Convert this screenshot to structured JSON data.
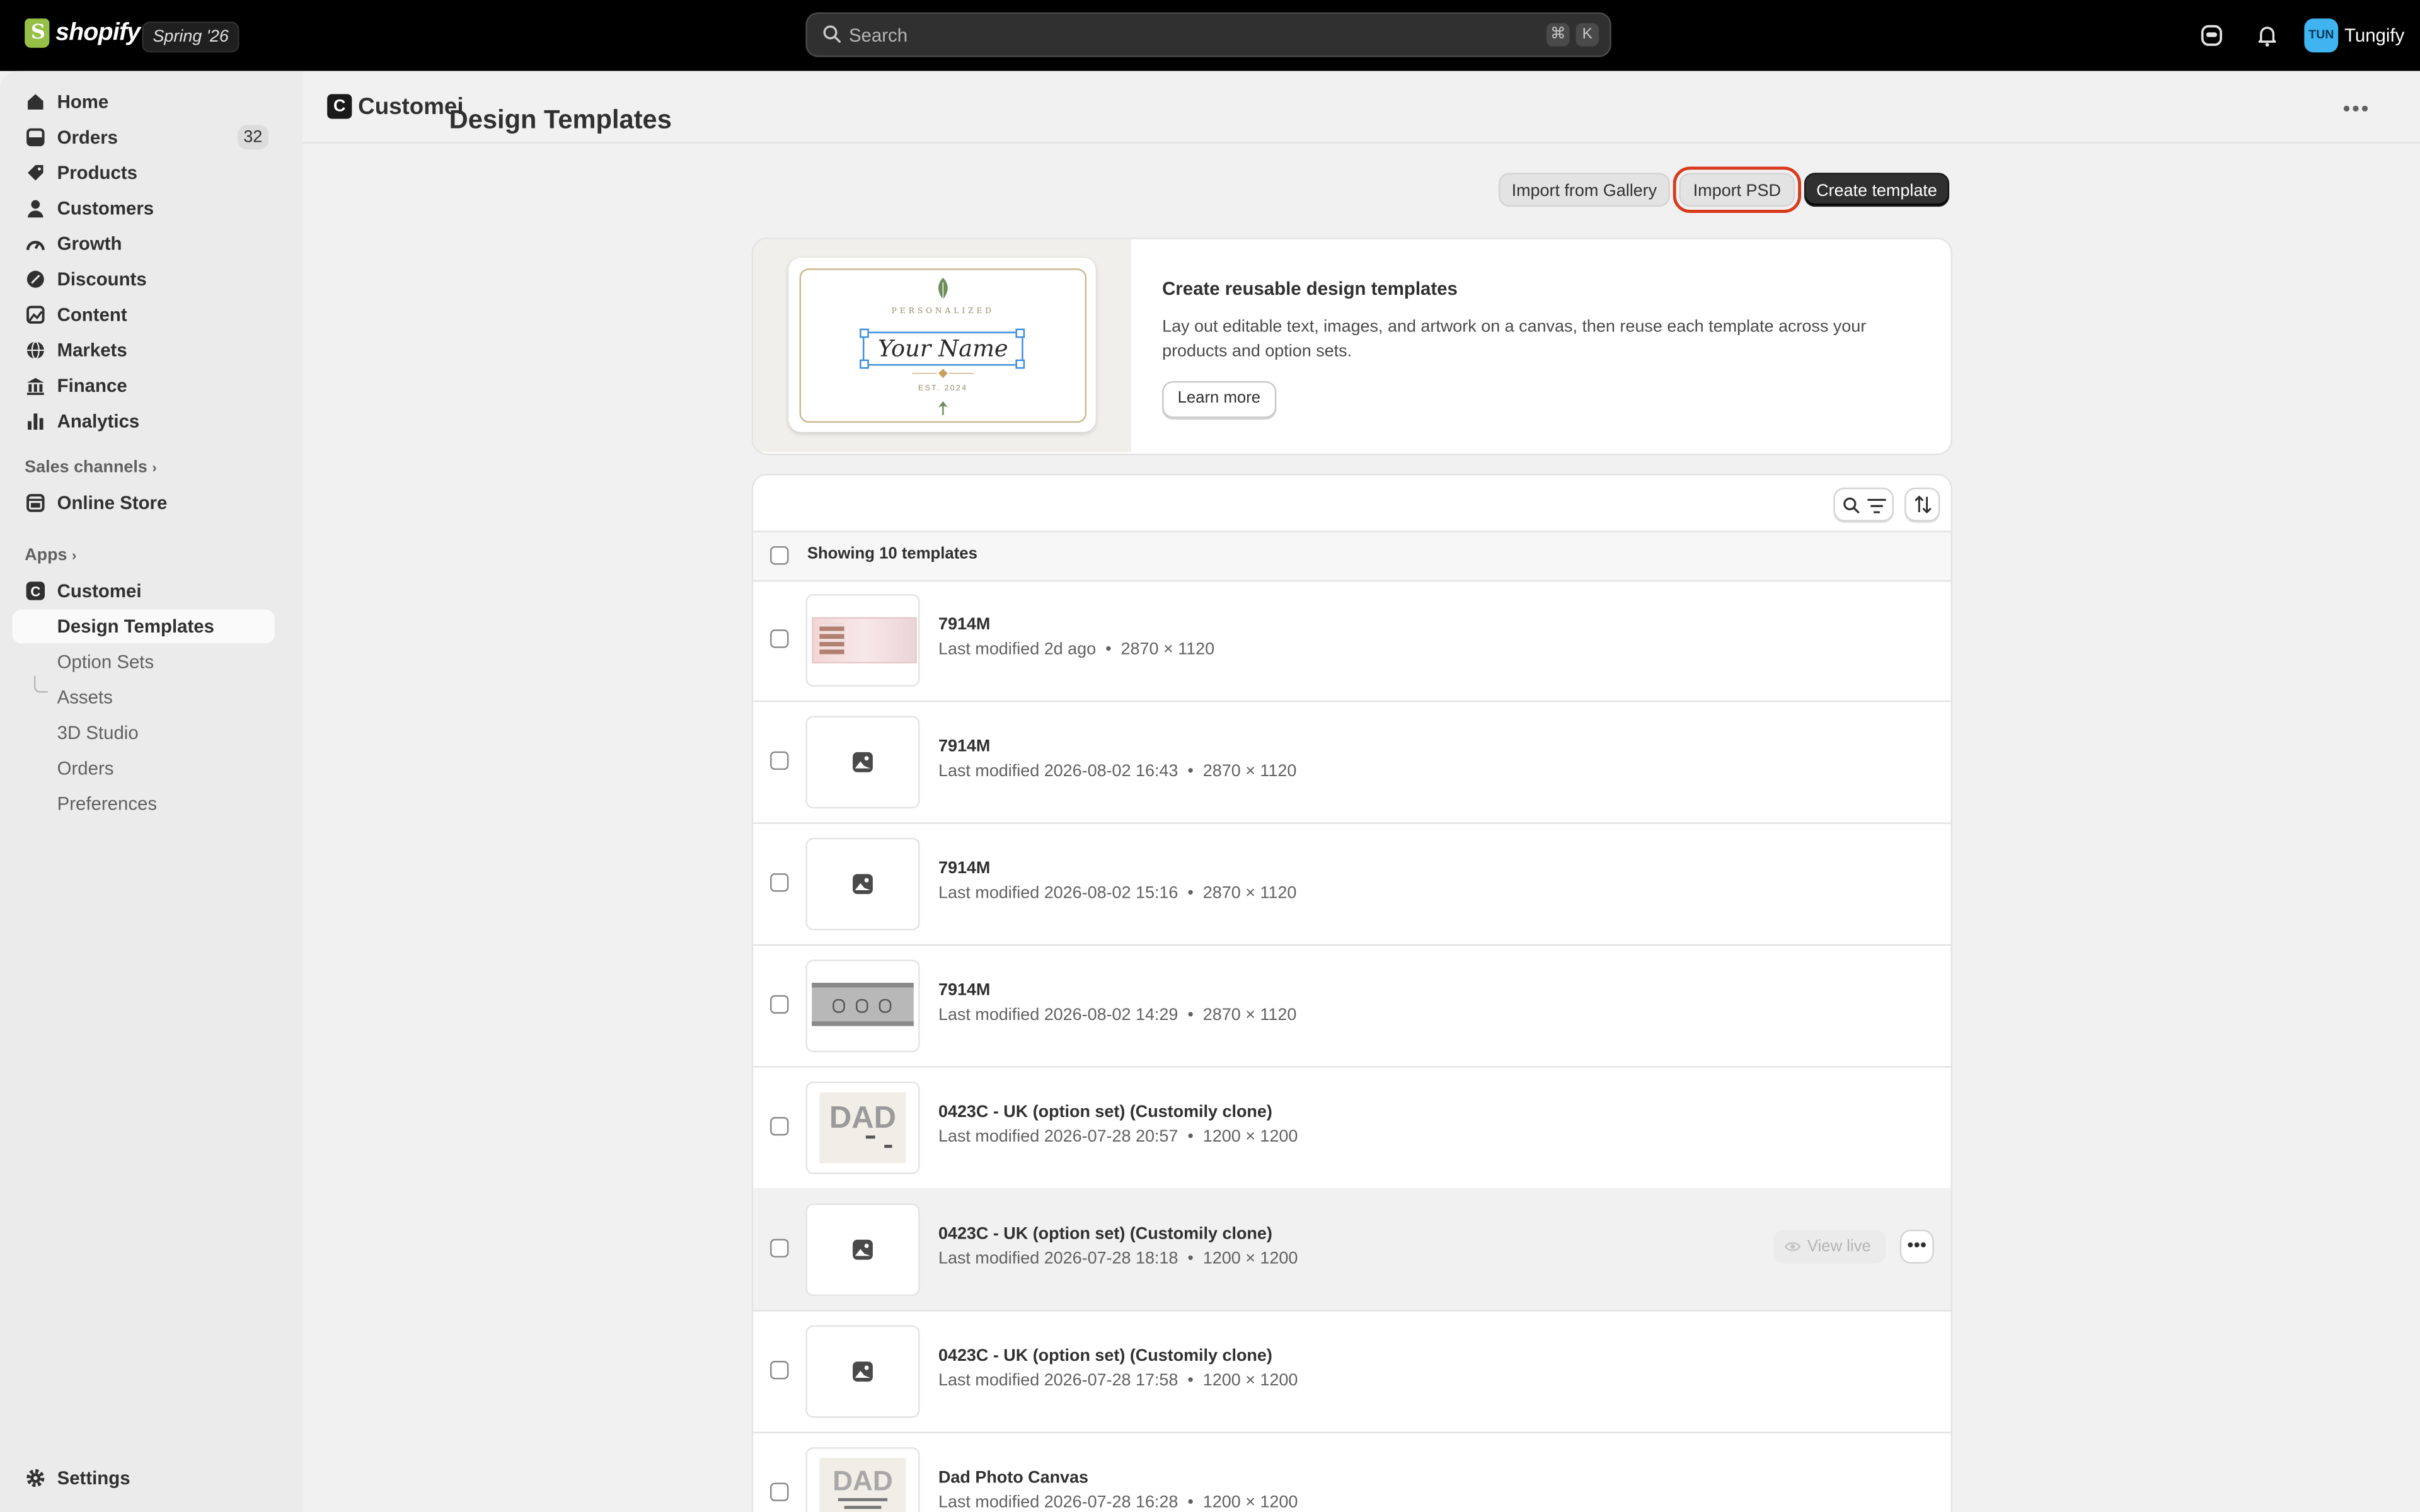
{
  "topbar": {
    "brand": "shopify",
    "season_badge": "Spring '26",
    "search_placeholder": "Search",
    "shortcut_keys": [
      "⌘",
      "K"
    ],
    "avatar_initials": "TUN",
    "store_name": "Tungify"
  },
  "sidebar": {
    "main_items": [
      {
        "label": "Home",
        "icon": "home-icon"
      },
      {
        "label": "Orders",
        "icon": "orders-icon",
        "badge": "32"
      },
      {
        "label": "Products",
        "icon": "tag-icon"
      },
      {
        "label": "Customers",
        "icon": "person-icon"
      },
      {
        "label": "Growth",
        "icon": "gauge-icon"
      },
      {
        "label": "Discounts",
        "icon": "discount-icon"
      },
      {
        "label": "Content",
        "icon": "content-icon"
      },
      {
        "label": "Markets",
        "icon": "globe-icon"
      },
      {
        "label": "Finance",
        "icon": "bank-icon"
      },
      {
        "label": "Analytics",
        "icon": "chart-icon"
      }
    ],
    "sales_channels_label": "Sales channels",
    "online_store": "Online Store",
    "apps_label": "Apps",
    "app_name": "Customei",
    "app_subitems": [
      "Design Templates",
      "Option Sets",
      "Assets",
      "3D Studio",
      "Orders",
      "Preferences"
    ],
    "active_subitem": "Design Templates",
    "settings": "Settings"
  },
  "app_header": {
    "icon_letter": "C",
    "title": "Customei"
  },
  "page": {
    "title": "Design Templates",
    "buttons": {
      "import_gallery": "Import from Gallery",
      "import_psd": "Import PSD",
      "create": "Create template"
    }
  },
  "banner": {
    "preview": {
      "personalized": "PERSONALIZED",
      "name": "Your Name",
      "est": "EST. 2024"
    },
    "heading": "Create reusable design templates",
    "body": "Lay out editable text, images, and artwork on a canvas, then reuse each template across your products and option sets.",
    "learn_more": "Learn more"
  },
  "list": {
    "showing": "Showing 10 templates",
    "view_live": "View live",
    "rows": [
      {
        "title": "7914M",
        "modified": "Last modified 2d ago",
        "size": "2870 × 1120",
        "thumb": "banner-photo"
      },
      {
        "title": "7914M",
        "modified": "Last modified 2026-08-02 16:43",
        "size": "2870 × 1120",
        "thumb": "placeholder"
      },
      {
        "title": "7914M",
        "modified": "Last modified 2026-08-02 15:16",
        "size": "2870 × 1120",
        "thumb": "placeholder"
      },
      {
        "title": "7914M",
        "modified": "Last modified 2026-08-02 14:29",
        "size": "2870 × 1120",
        "thumb": "grey-banner"
      },
      {
        "title": "0423C - UK (option set) (Customily clone)",
        "modified": "Last modified 2026-07-28 20:57",
        "size": "1200 × 1200",
        "thumb": "dad"
      },
      {
        "title": "0423C - UK (option set) (Customily clone)",
        "modified": "Last modified 2026-07-28 18:18",
        "size": "1200 × 1200",
        "thumb": "placeholder",
        "hover": true
      },
      {
        "title": "0423C - UK (option set) (Customily clone)",
        "modified": "Last modified 2026-07-28 17:58",
        "size": "1200 × 1200",
        "thumb": "placeholder"
      },
      {
        "title": "Dad Photo Canvas",
        "modified": "Last modified 2026-07-28 16:28",
        "size": "1200 × 1200",
        "thumb": "dad-canvas"
      }
    ]
  },
  "colors": {
    "topbar": "#000000",
    "primary_button": "#303030",
    "highlight_outline": "#d83a1c",
    "avatar": "#3fb4f0",
    "selection_blue": "#3b8de0"
  }
}
